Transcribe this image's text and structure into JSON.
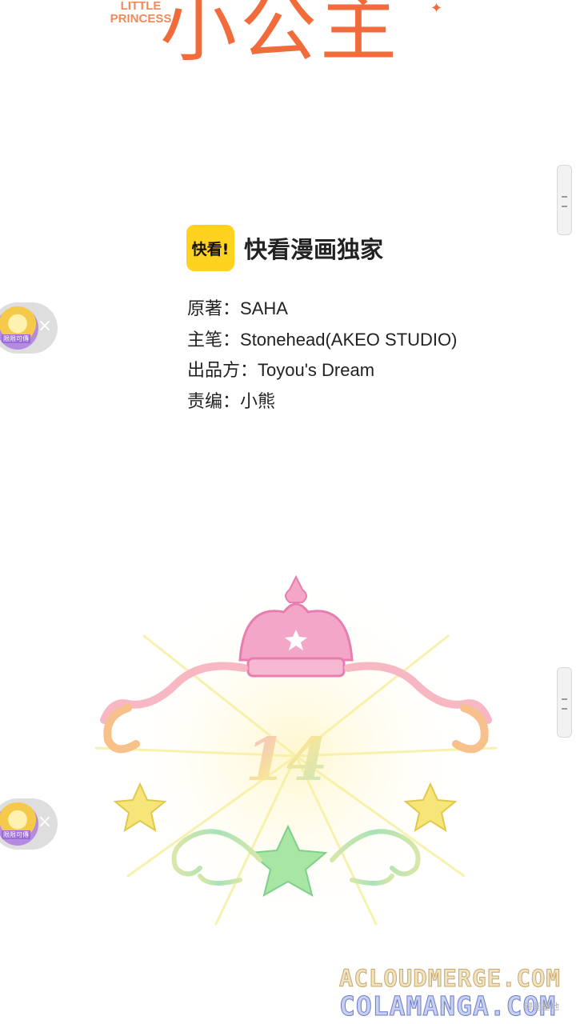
{
  "banner": {
    "title_en": "LITTLE PRINCESS",
    "title_cn": "小公主"
  },
  "credits": {
    "brand_logo": "快看!",
    "brand_text": "快看漫画独家",
    "lines": [
      {
        "label": "原著：",
        "value": "SAHA"
      },
      {
        "label": "主笔：",
        "value": "Stonehead(AKEO STUDIO)"
      },
      {
        "label": "出品方：",
        "value": "Toyou's Dream"
      },
      {
        "label": "责编：",
        "value": "小熊"
      }
    ]
  },
  "chapter": {
    "number": "14"
  },
  "float_ads": [
    {
      "badge_text": "限限可傳",
      "close": "×"
    },
    {
      "badge_text": "限限可傳",
      "close": "×"
    }
  ],
  "watermark": {
    "line1": "ACLOUDMERGE.COM",
    "line2": "COLAMANGA.COM",
    "small": "漫画基地"
  },
  "colors": {
    "title_orange": "#f26b3a",
    "brand_yellow": "#ffd21f",
    "crown_pink": "#f4a6c8"
  }
}
